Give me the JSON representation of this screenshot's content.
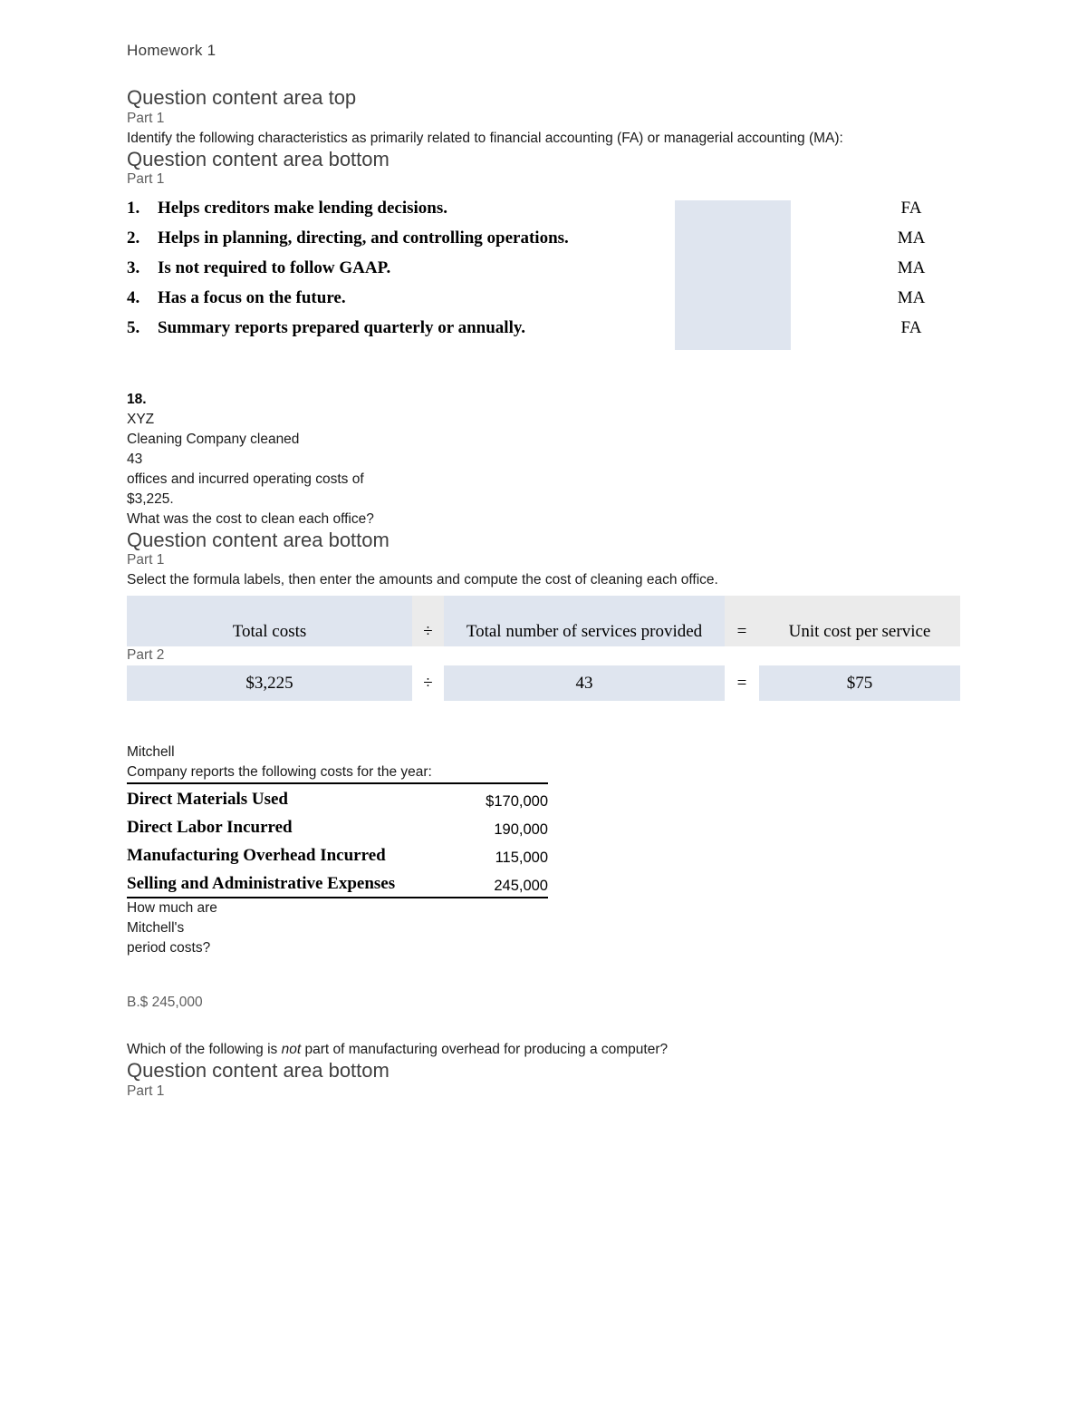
{
  "document": {
    "title": "Homework 1"
  },
  "section1": {
    "heading_top": "Question content area top",
    "part_label_1": "Part 1",
    "prompt": "Identify the following characteristics as primarily related to financial accounting (FA) or managerial accounting (MA):",
    "heading_bottom": "Question content area bottom",
    "part_label_2": "Part 1",
    "items": [
      {
        "num": "1.",
        "text": "Helps creditors make lending decisions.",
        "answer": "FA"
      },
      {
        "num": "2.",
        "text": "Helps in planning, directing, and controlling operations.",
        "answer": "MA"
      },
      {
        "num": "3.",
        "text": "Is not required to follow GAAP.",
        "answer": "MA"
      },
      {
        "num": "4.",
        "text": "Has a focus on the future.",
        "answer": "MA"
      },
      {
        "num": "5.",
        "text": "Summary reports prepared quarterly or annually.",
        "answer": "FA"
      }
    ],
    "shade_color": "#dfe5ef"
  },
  "section18": {
    "number": "18.",
    "line1": "XYZ",
    "line2": "Cleaning Company cleaned",
    "line3": "43",
    "line4": "offices and incurred operating costs of",
    "line5": "$3,225.",
    "line6": "What was the cost to clean each office?",
    "heading_bottom": "Question content area bottom",
    "part_label_1": "Part 1",
    "instruction": "Select the formula labels, then enter the amounts and compute the cost of cleaning each office.",
    "part_label_2": "Part 2",
    "formula_header": {
      "term1": "Total costs",
      "operator": "÷",
      "term2": "Total number of services provided",
      "equals": "=",
      "result": "Unit cost per service"
    },
    "formula_values": {
      "term1": "$3,225",
      "operator": "÷",
      "term2": "43",
      "equals": "=",
      "result": "$75"
    }
  },
  "mitchell": {
    "intro_line1": "Mitchell",
    "intro_line2": "Company reports the following costs for the year:",
    "rows": [
      {
        "label": "Direct Materials Used",
        "value": "$170,000"
      },
      {
        "label": "Direct Labor Incurred",
        "value": "190,000"
      },
      {
        "label": "Manufacturing Overhead Incurred",
        "value": "115,000"
      },
      {
        "label": "Selling and Administrative Expenses",
        "value": "245,000"
      }
    ],
    "question_line1": "How much are",
    "question_line2": "Mitchell's",
    "question_line3": "period costs?",
    "answer": "B.$ 245,000"
  },
  "section_overhead": {
    "question_part1": "Which of the following is ",
    "question_italic": "not",
    "question_part2": " part of manufacturing overhead for producing a computer?",
    "heading_bottom": "Question content area bottom",
    "part_label": "Part 1"
  }
}
